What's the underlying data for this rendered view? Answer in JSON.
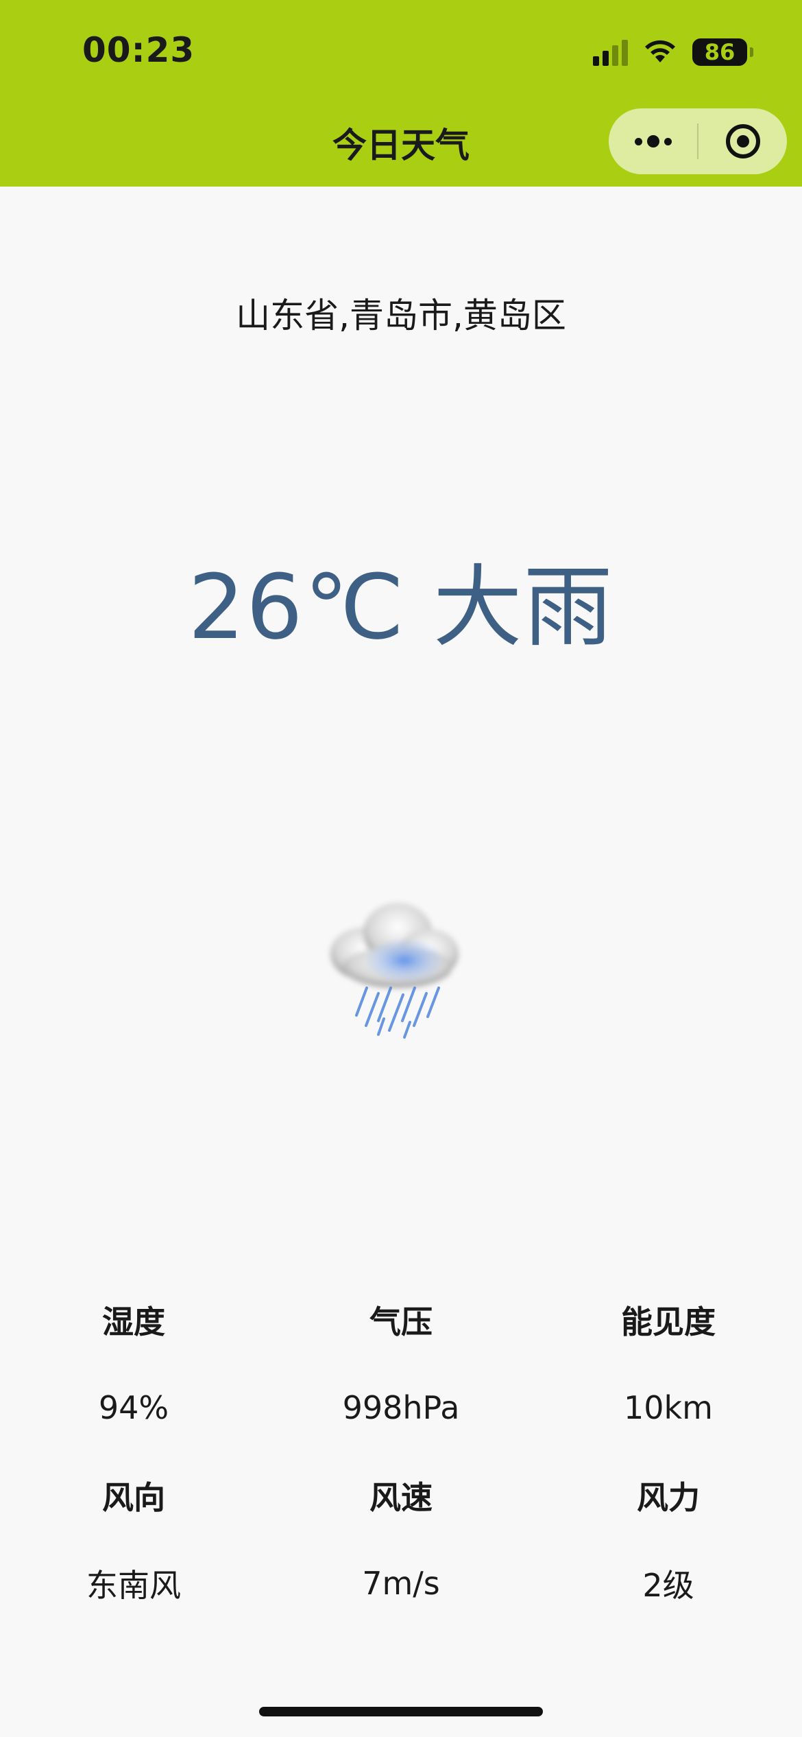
{
  "status_bar": {
    "time": "00:23",
    "battery": "86"
  },
  "nav": {
    "title": "今日天气",
    "capsule_icons": [
      "more-icon",
      "target-close-icon"
    ]
  },
  "location": "山东省,青岛市,黄岛区",
  "current": {
    "temperature": "26℃",
    "condition": "大雨",
    "icon": "heavy-rain-cloud-icon",
    "accent_color": "#3e6085"
  },
  "details": [
    [
      {
        "label": "湿度",
        "value": "94%"
      },
      {
        "label": "气压",
        "value": "998hPa"
      },
      {
        "label": "能见度",
        "value": "10km"
      }
    ],
    [
      {
        "label": "风向",
        "value": "东南风"
      },
      {
        "label": "风速",
        "value": "7m/s"
      },
      {
        "label": "风力",
        "value": "2级"
      }
    ]
  ],
  "theme": {
    "header_color": "#aacf12",
    "background": "#f8f8f8"
  }
}
